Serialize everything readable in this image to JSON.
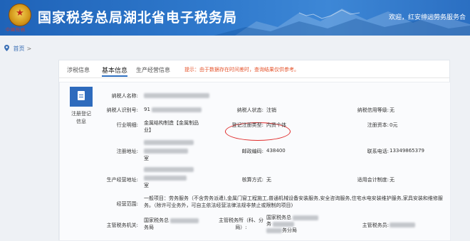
{
  "header": {
    "emblem_text": "中國稅務",
    "site_title": "国家税务总局湖北省电子税务局",
    "welcome": "欢迎，红安绅远劳务服务合"
  },
  "breadcrumb": {
    "home": "首页",
    "separator": ">"
  },
  "tabs": [
    {
      "label": "涉税信息",
      "active": false
    },
    {
      "label": "基本信息",
      "active": true
    },
    {
      "label": "生产经营信息",
      "active": false
    }
  ],
  "tip": "提示：由于数据存在时间差时，查询结果仅供参考。",
  "section": {
    "icon": "document-icon",
    "label_line1": "注册登记",
    "label_line2": "信息"
  },
  "fields": {
    "taxpayer_name_label": "纳税人名称:",
    "taxpayer_id_label": "纳税人识别号:",
    "taxpayer_id_value": "91",
    "taxpayer_status_label": "纳税人状态:",
    "taxpayer_status_value": "注销",
    "credit_level_label": "纳税信用等级:",
    "credit_level_value": "无",
    "industry_label": "行业明细:",
    "industry_value": "金属结构制造【金属制品业】",
    "reg_type_label": "登记注册类型:",
    "reg_type_value": "内资个体",
    "reg_capital_label": "注册资本:",
    "reg_capital_value": "0元",
    "reg_address_label": "注册地址:",
    "reg_address_tail": "室",
    "postal_code_label": "邮政编码:",
    "postal_code_value": "438400",
    "phone_label": "联系电话:",
    "phone_value": "13349865379",
    "business_address_label": "生产经营地址:",
    "business_address_tail": "室",
    "verify_method_label": "核算方式:",
    "verify_method_value": "无",
    "accounting_label": "适用会计制度:",
    "accounting_value": "无",
    "scope_label": "经营范围:",
    "scope_value": "一般项目：劳务服务（不含劳务派遣),金属门窗工程施工,普通机械设备安装服务,安全咨询服务,住宅水电安装维护服务,家具安装和维修服务。（除许可业务外，可自主依法经营法律法规非禁止或限制的项目)",
    "tax_authority_label": "主管税务机关:",
    "tax_authority_value_1": "国家税务总",
    "tax_authority_value_2": "务局",
    "tax_office_label_1": "主管税务所（科、分",
    "tax_office_label_2": "局）:",
    "tax_office_value_1": "国家税务总",
    "tax_office_value_2": "务",
    "tax_office_value_3": "务分局",
    "tax_officer_label": "主管税务员:"
  }
}
